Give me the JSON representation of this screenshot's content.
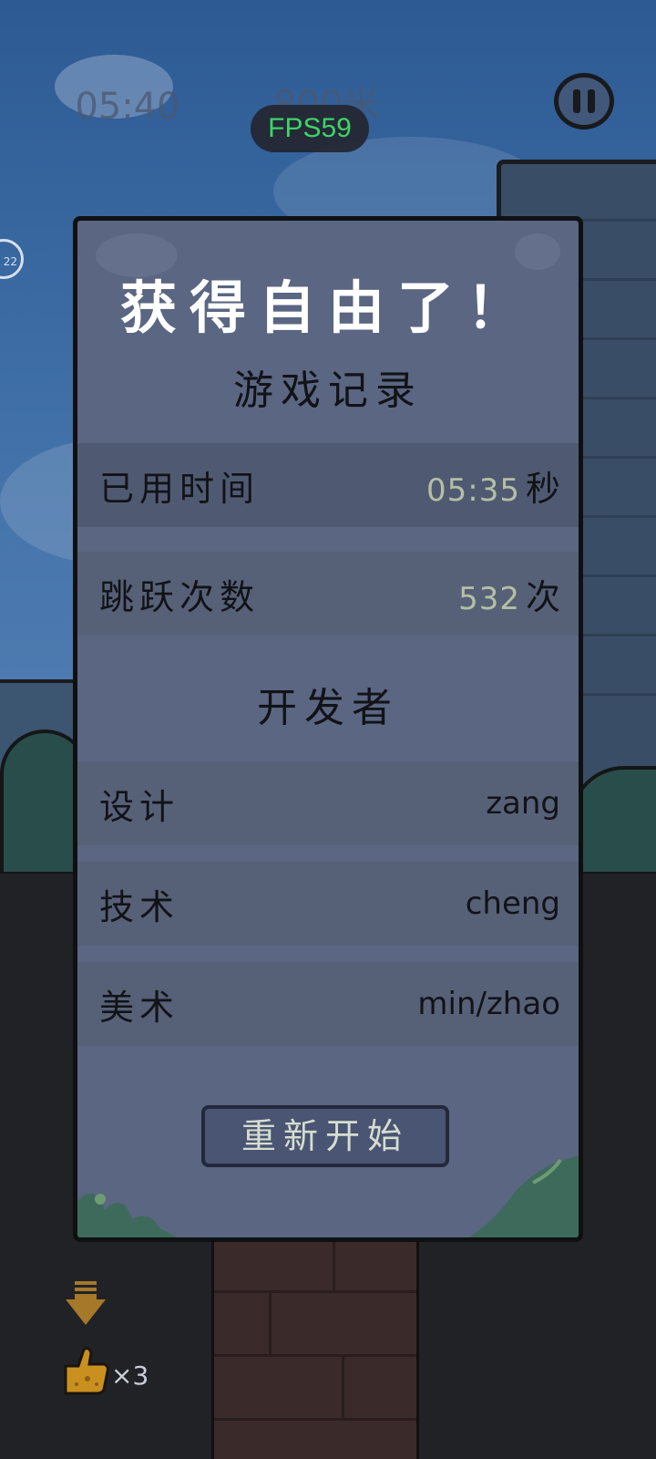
{
  "hud": {
    "time": "05:40",
    "distance": "800米",
    "fps": "FPS59",
    "side_badge": "22",
    "pause_icon": "pause-icon"
  },
  "dialog": {
    "title": "获得自由了！",
    "record_header": "游戏记录",
    "records": [
      {
        "label": "已用时间",
        "value": "05:35",
        "unit": "秒"
      },
      {
        "label": "跳跃次数",
        "value": "532",
        "unit": "次"
      }
    ],
    "dev_header": "开发者",
    "developers": [
      {
        "role": "设计",
        "name": "zang"
      },
      {
        "role": "技术",
        "name": "cheng"
      },
      {
        "role": "美术",
        "name": "min/zhao"
      }
    ],
    "restart_label": "重新开始"
  },
  "item": {
    "arrow_icon": "down-arrow-icon",
    "thumb_icon": "thumbs-up-icon",
    "count": "×3"
  },
  "colors": {
    "dialog_bg": "#5a6682",
    "fps_text": "#3fd467",
    "number_text": "#b4bfa4"
  }
}
